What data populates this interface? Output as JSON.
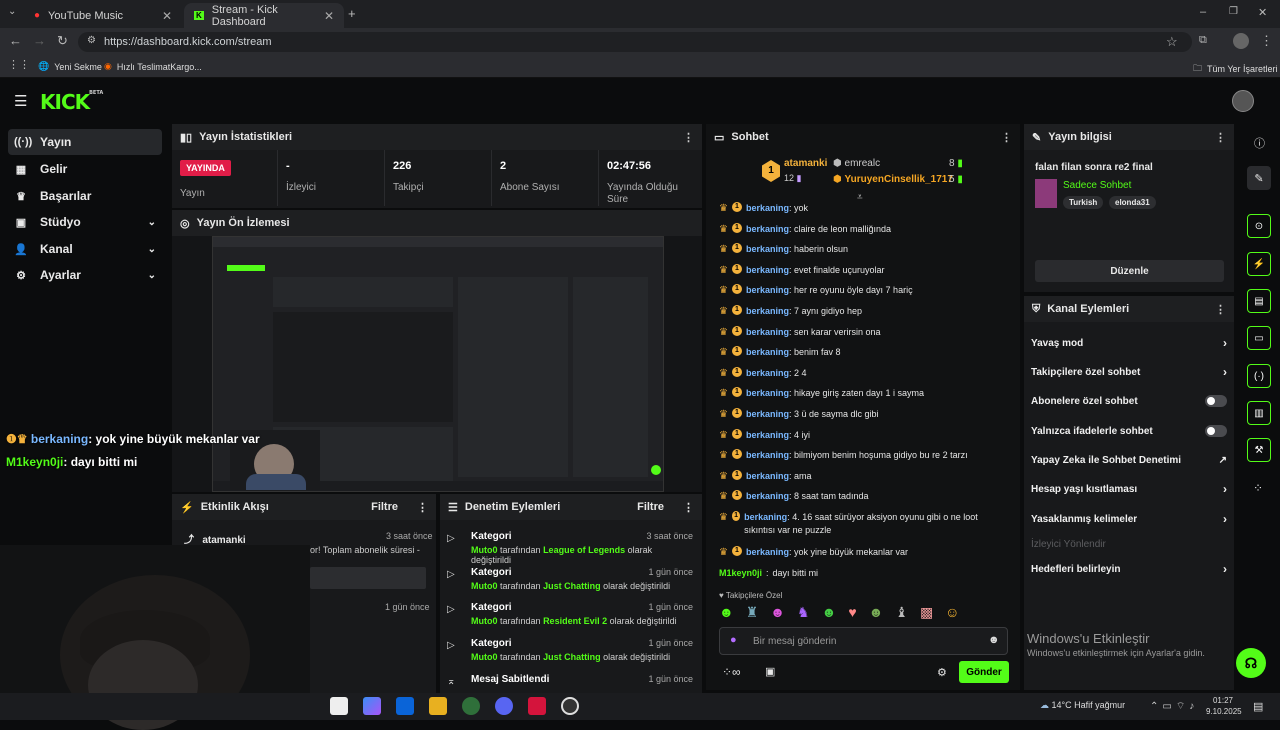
{
  "browser": {
    "tabs": [
      {
        "label": "YouTube Music",
        "active": false
      },
      {
        "label": "Stream - Kick Dashboard",
        "active": true
      }
    ],
    "url": "https://dashboard.kick.com/stream",
    "bookmarks": [
      "Yeni Sekme",
      "Hızlı TeslimatKargo...",
      "Tüm Yer İşaretleri"
    ]
  },
  "nav": {
    "logo": "KICK",
    "logo_sup": "BETA",
    "items": [
      {
        "label": "Yayın",
        "icon": "broadcast-icon",
        "glyph": "((·))",
        "active": true
      },
      {
        "label": "Gelir",
        "icon": "income-icon",
        "glyph": "▦"
      },
      {
        "label": "Başarılar",
        "icon": "trophy-icon",
        "glyph": "♛"
      },
      {
        "label": "Stüdyo",
        "icon": "studio-icon",
        "glyph": "▣",
        "chev": "⌄"
      },
      {
        "label": "Kanal",
        "icon": "channel-icon",
        "glyph": "👤",
        "chev": "⌄"
      },
      {
        "label": "Ayarlar",
        "icon": "settings-icon",
        "glyph": "⚙",
        "chev": "⌄"
      }
    ]
  },
  "stats": {
    "title": "Yayın İstatistikleri",
    "live_badge": "YAYINDA",
    "items": [
      {
        "value": "",
        "label": "Yayın"
      },
      {
        "value": "-",
        "label": "İzleyici"
      },
      {
        "value": "226",
        "label": "Takipçi"
      },
      {
        "value": "2",
        "label": "Abone Sayısı"
      },
      {
        "value": "02:47:56",
        "label": "Yayında Olduğu Süre"
      }
    ]
  },
  "preview": {
    "title": "Yayın Ön İzlemesi"
  },
  "overlay_chat": [
    {
      "user": "berkaning",
      "text": ": yok yine büyük mekanlar var"
    },
    {
      "user": "M1keyn0ji",
      "text": ": dayı bitti mi"
    }
  ],
  "activity": {
    "title": "Etkinlik Akışı",
    "filter": "Filtre",
    "items": [
      {
        "name": "atamanki",
        "time": "3 saat önce",
        "text": "or! Toplam abonelik süresi -"
      },
      {
        "name": "",
        "time": "1 gün önce",
        "text": ""
      }
    ]
  },
  "mod": {
    "title": "Denetim Eylemleri",
    "filter": "Filtre",
    "items": [
      {
        "title": "Kategori",
        "time": "3 saat önce",
        "by": "Muto0",
        "mid": "tarafından",
        "value": "League of Legends",
        "suffix": "olarak değiştirildi"
      },
      {
        "title": "Kategori",
        "time": "1 gün önce",
        "by": "Muto0",
        "mid": "tarafından",
        "value": "Just Chatting",
        "suffix": "olarak değiştirildi"
      },
      {
        "title": "Kategori",
        "time": "1 gün önce",
        "by": "Muto0",
        "mid": "tarafından",
        "value": "Resident Evil 2",
        "suffix": "olarak değiştirildi"
      },
      {
        "title": "Kategori",
        "time": "1 gün önce",
        "by": "Muto0",
        "mid": "tarafından",
        "value": "Just Chatting",
        "suffix": "olarak değiştirildi"
      },
      {
        "title": "Mesaj Sabitlendi",
        "time": "1 gün önce"
      }
    ]
  },
  "chat": {
    "title": "Sohbet",
    "top_gifters": [
      {
        "name": "atamanki",
        "count": "12",
        "rank": "1"
      },
      {
        "name": "emrealc",
        "count": "8"
      },
      {
        "name": "YuruyenCinsellik_1717",
        "count": "5"
      }
    ],
    "messages": [
      {
        "user": "berkaning",
        "text": "yok"
      },
      {
        "user": "berkaning",
        "text": "claire de leon malliğında"
      },
      {
        "user": "berkaning",
        "text": "haberin olsun"
      },
      {
        "user": "berkaning",
        "text": "evet finalde uçuruyolar"
      },
      {
        "user": "berkaning",
        "text": "her re oyunu öyle dayı 7 hariç"
      },
      {
        "user": "berkaning",
        "text": "7 aynı gidiyo hep"
      },
      {
        "user": "berkaning",
        "text": "sen karar verirsin ona"
      },
      {
        "user": "berkaning",
        "text": "benim fav 8"
      },
      {
        "user": "berkaning",
        "text": "2 4"
      },
      {
        "user": "berkaning",
        "text": "hikaye giriş zaten dayı 1 i sayma"
      },
      {
        "user": "berkaning",
        "text": "3 ü de sayma dlc gibi"
      },
      {
        "user": "berkaning",
        "text": "4 iyi"
      },
      {
        "user": "berkaning",
        "text": "bilmiyom benim hoşuma gidiyo bu re 2 tarzı"
      },
      {
        "user": "berkaning",
        "text": "ama"
      },
      {
        "user": "berkaning",
        "text": "8 saat tam tadında"
      },
      {
        "user": "berkaning",
        "text": "4. 16 saat sürüyor aksiyon oyunu gibi o ne loot sıkıntısı var ne puzzle"
      },
      {
        "user": "berkaning",
        "text": "yok yine büyük mekanlar var"
      }
    ],
    "last_message": {
      "user": "M1keyn0ji",
      "text": "dayı bitti mi"
    },
    "followers_only": "Takipçilere Özel",
    "placeholder": "Bir mesaj gönderin",
    "send": "Gönder"
  },
  "info": {
    "title": "Yayın bilgisi",
    "stream_title": "falan filan sonra re2 final",
    "category": "Sadece Sohbet",
    "tags": [
      "Turkish",
      "elonda31"
    ],
    "edit": "Düzenle"
  },
  "channel_actions": {
    "title": "Kanal Eylemleri",
    "items": [
      {
        "label": "Yavaş mod",
        "kind": "chev"
      },
      {
        "label": "Takipçilere özel sohbet",
        "kind": "chev"
      },
      {
        "label": "Abonelere özel sohbet",
        "kind": "toggle"
      },
      {
        "label": "Yalnızca ifadelerle sohbet",
        "kind": "toggle"
      },
      {
        "label": "Yapay Zeka ile Sohbet Denetimi",
        "kind": "ext"
      },
      {
        "label": "Hesap yaşı kısıtlaması",
        "kind": "chev"
      },
      {
        "label": "Yasaklanmış kelimeler",
        "kind": "chev"
      },
      {
        "label": "İzleyici Yönlendir",
        "kind": "disabled"
      },
      {
        "label": "Hedefleri belirleyin",
        "kind": "chev"
      }
    ]
  },
  "windows": {
    "activate_title": "Windows'u Etkinleştir",
    "activate_sub": "Windows'u etkinleştirmek için Ayarlar'a gidin.",
    "weather": "14°C  Hafif yağmur",
    "time": "01:27",
    "date": "9.10.2025"
  },
  "colors": {
    "accent": "#53fc18",
    "live": "#e11d48",
    "bg": "#0b0c0d"
  }
}
